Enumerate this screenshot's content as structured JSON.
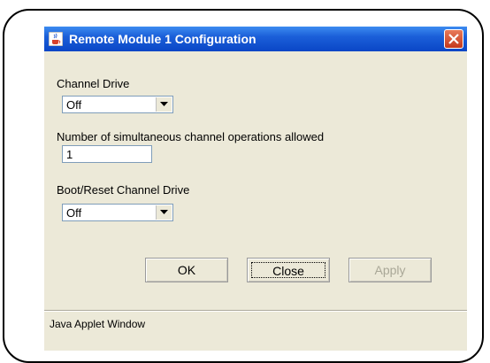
{
  "window": {
    "title": "Remote Module 1 Configuration",
    "title_icon": "java-cup-icon",
    "close_icon": "close-icon"
  },
  "fields": {
    "channel_drive": {
      "label": "Channel Drive",
      "value": "Off"
    },
    "simultaneous_ops": {
      "label": "Number of simultaneous channel operations allowed",
      "value": "1"
    },
    "boot_reset_drive": {
      "label": "Boot/Reset Channel Drive",
      "value": "Off"
    }
  },
  "buttons": {
    "ok": "OK",
    "close": "Close",
    "apply": "Apply"
  },
  "status": {
    "text": "Java Applet Window"
  },
  "colors": {
    "window_bg": "#ece9d8",
    "title_bar": "#0a46c6",
    "close_button": "#c4391d",
    "disabled_text": "#a9a797"
  }
}
